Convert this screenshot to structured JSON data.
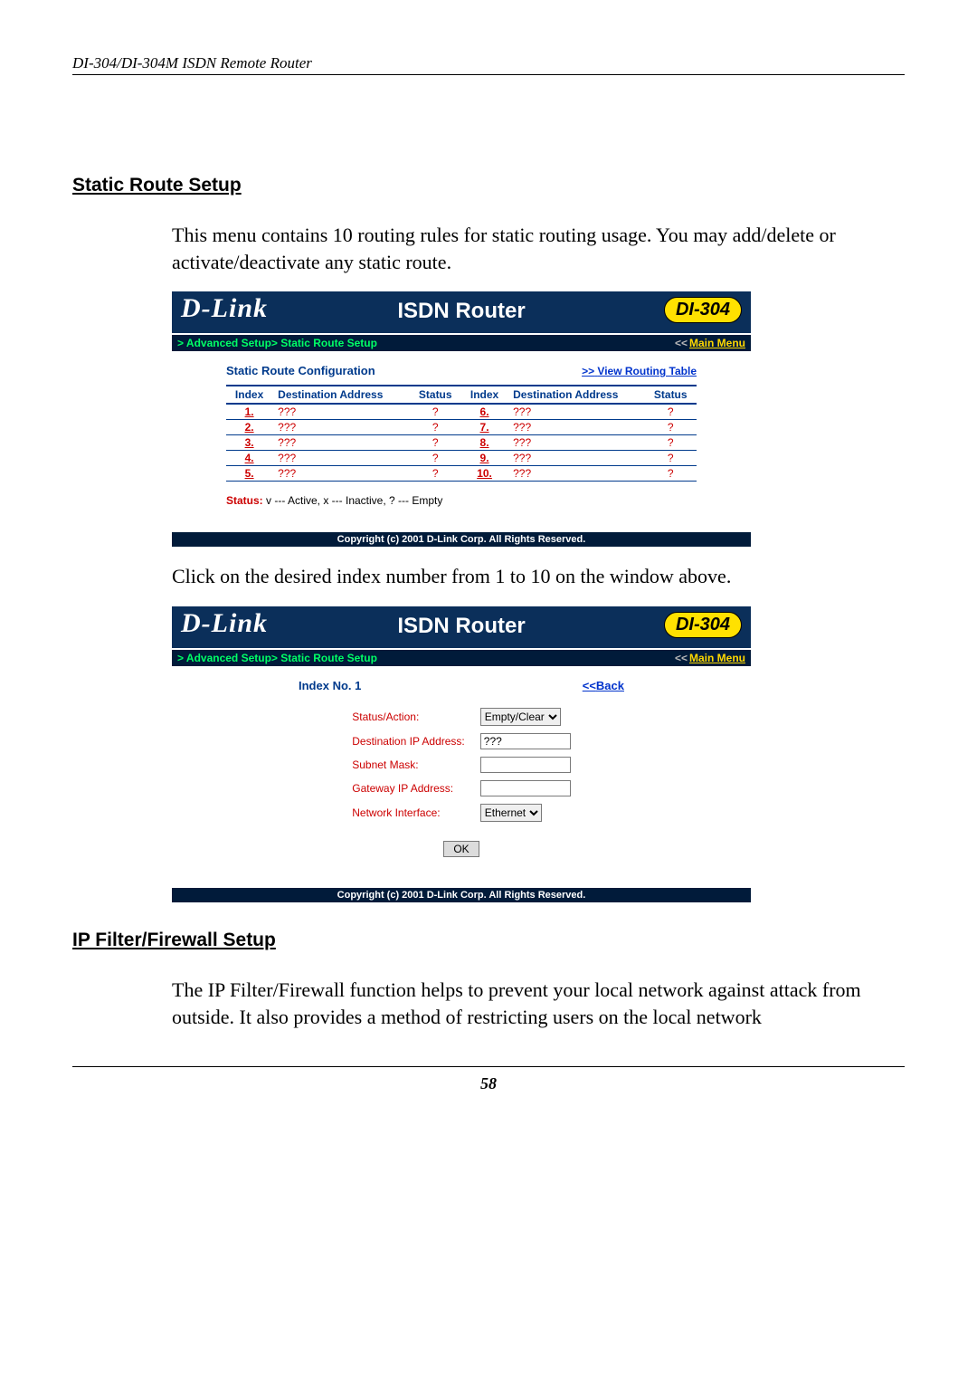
{
  "running_head": "DI-304/DI-304M ISDN Remote Router",
  "page_number": "58",
  "sections": {
    "static_route": {
      "heading": "Static Route Setup",
      "intro": "This menu contains 10 routing rules for static routing usage. You may add/delete or activate/deactivate any static route.",
      "after_fig1": "Click on the desired index number from 1 to 10 on the window above."
    },
    "firewall": {
      "heading": "IP Filter/Firewall Setup",
      "intro": "The IP Filter/Firewall function helps to prevent your local network against attack from outside. It also provides a method of restricting users on the local network"
    }
  },
  "router_common": {
    "brand": "D-Link",
    "title": "ISDN Router",
    "model": "DI-304",
    "breadcrumb": "> Advanced Setup> Static Route Setup",
    "main_menu_arrows": "<<",
    "main_menu": "Main Menu",
    "footer": "Copyright (c) 2001 D-Link Corp. All Rights Reserved."
  },
  "fig1": {
    "section_title": "Static Route Configuration",
    "view_link_arrows": ">>",
    "view_link": "View Routing Table",
    "columns": {
      "index": "Index",
      "dest": "Destination Address",
      "status": "Status"
    },
    "rows_left": [
      {
        "idx": "1.",
        "dest": "???",
        "status": "?"
      },
      {
        "idx": "2.",
        "dest": "???",
        "status": "?"
      },
      {
        "idx": "3.",
        "dest": "???",
        "status": "?"
      },
      {
        "idx": "4.",
        "dest": "???",
        "status": "?"
      },
      {
        "idx": "5.",
        "dest": "???",
        "status": "?"
      }
    ],
    "rows_right": [
      {
        "idx": "6.",
        "dest": "???",
        "status": "?"
      },
      {
        "idx": "7.",
        "dest": "???",
        "status": "?"
      },
      {
        "idx": "8.",
        "dest": "???",
        "status": "?"
      },
      {
        "idx": "9.",
        "dest": "???",
        "status": "?"
      },
      {
        "idx": "10.",
        "dest": "???",
        "status": "?"
      }
    ],
    "legend_label": "Status:",
    "legend_text": " v --- Active, x --- Inactive, ? --- Empty"
  },
  "fig2": {
    "index_label": "Index No. 1",
    "back_arrows": "<<",
    "back": "Back",
    "fields": {
      "status_action": "Status/Action:",
      "dest_ip": "Destination IP Address:",
      "subnet": "Subnet Mask:",
      "gateway": "Gateway IP Address:",
      "iface": "Network Interface:"
    },
    "values": {
      "status_action": "Empty/Clear",
      "dest_ip": "???",
      "subnet": "",
      "gateway": "",
      "iface": "Ethernet"
    },
    "ok": "OK"
  }
}
